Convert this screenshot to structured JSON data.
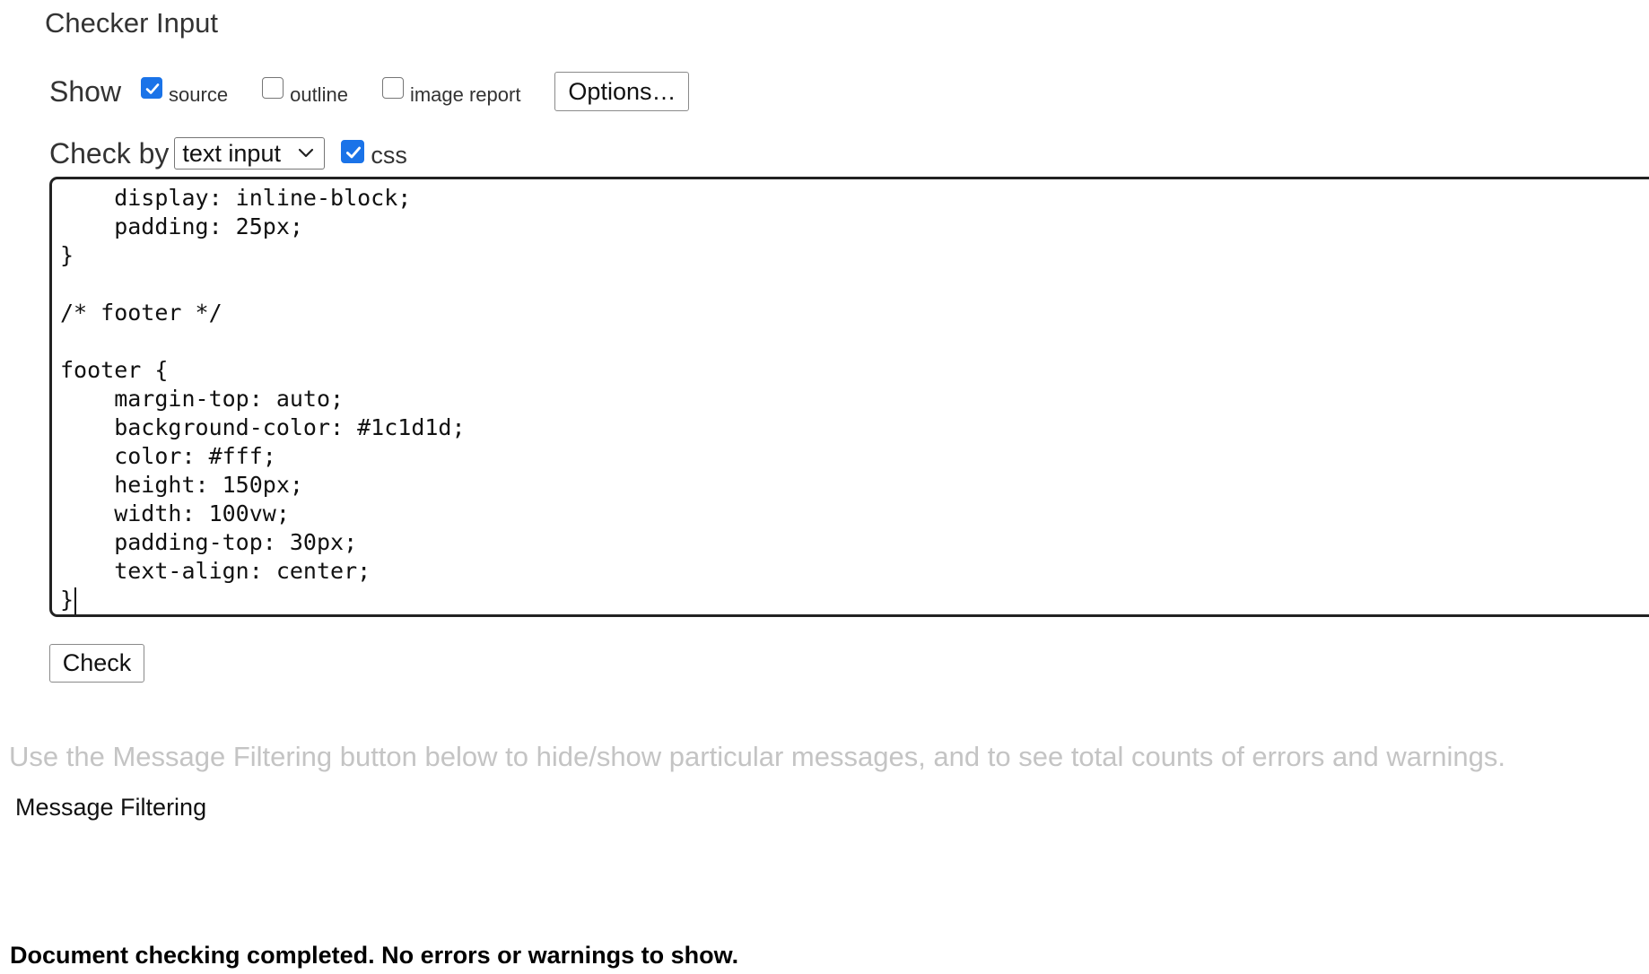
{
  "legend": "Checker Input",
  "show_row": {
    "label": "Show",
    "options": [
      {
        "label": "source",
        "checked": true
      },
      {
        "label": "outline",
        "checked": false
      },
      {
        "label": "image report",
        "checked": false
      }
    ],
    "options_button": "Options…"
  },
  "check_row": {
    "label": "Check by",
    "select_value": "text input",
    "css_label": "css",
    "css_checked": true
  },
  "code_lines": [
    "    display: inline-block;",
    "    padding: 25px;",
    "}",
    "",
    "/* footer */",
    "",
    "footer {",
    "    margin-top: auto;",
    "    background-color: #1c1d1d;",
    "    color: #fff;",
    "    height: 150px;",
    "    width: 100vw;",
    "    padding-top: 30px;",
    "    text-align: center;",
    "}"
  ],
  "check_button": "Check",
  "info_text": "Use the Message Filtering button below to hide/show particular messages, and to see total counts of errors and warnings.",
  "filter_label": "Message Filtering",
  "status_text": "Document checking completed. No errors or warnings to show.",
  "colors": {
    "checkbox_accent": "#1a73e8",
    "info_text": "#c4c4c4"
  }
}
